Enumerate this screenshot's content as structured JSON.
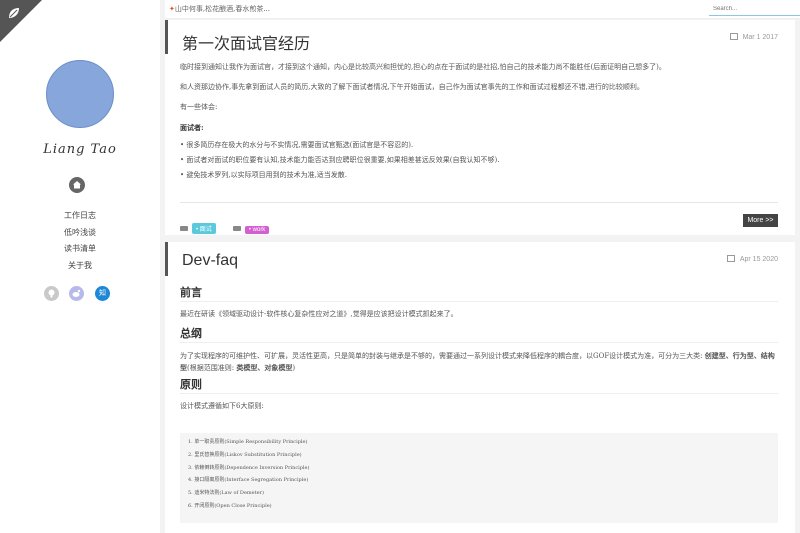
{
  "header": {
    "marquee": "山中何事,松花酿酒,春水煎茶...",
    "search_placeholder": "Search..."
  },
  "sidebar": {
    "author": "Liang Tao",
    "nav": [
      "工作日志",
      "低吟浅谈",
      "读书清单",
      "关于我"
    ],
    "social": [
      {
        "name": "github",
        "color": "#c9c9c9"
      },
      {
        "name": "weibo",
        "color": "#b6b9ea"
      },
      {
        "name": "zhihu",
        "label": "知",
        "color": "#1e88d6"
      }
    ]
  },
  "posts": [
    {
      "title": "第一次面试官经历",
      "date": "Mar 1 2017",
      "paragraphs": [
        "临时接到通知让我作为面试官，才接到这个通知，内心是比较高兴和担忧的,担心的点在于面试的是社招,怕自己的技术能力尚不能胜任(后面证明自己想多了)。",
        "和人资那边协作,事先拿到面试人员的简历,大致的了解下面试者情况,下午开始面试，自己作为面试官事先的工作和面试过程都还不错,进行的比较顺利。",
        "有一些体会:"
      ],
      "subhead": "面试者:",
      "bullets": [
        "• 很多简历存在极大的水分与不实情况,需要面试官甄选(面试官是不容忍的).",
        "• 面试者对面试的职位要有认知,技术能力能否达到应聘职位很重要,如果相差甚远反效果(自我认知不够).",
        "• 避免技术罗列,以实际项目用到的技术为准,适当发散."
      ],
      "tags": [
        {
          "label": "• 面试",
          "color": "#5bc9dc"
        },
        {
          "label": "• work",
          "color": "#d35fd0"
        }
      ],
      "more": "More >>"
    },
    {
      "title": "Dev-faq",
      "date": "Apr 15 2020",
      "sections": [
        {
          "heading": "前言",
          "text": "最近在研读《领域驱动设计-软件核心复杂性应对之道》,觉得是应该把设计模式抓起来了。"
        },
        {
          "heading": "总纲",
          "text_a": "为了实现程序的可维护性、可扩展，灵活性更高，只是简单的封装与继承是不够的，需要通过一系列设计模式来降低程序的耦合度，以GOF设计模式为准，可分为三大类: ",
          "bold_a": "创建型、行为型、结构型",
          "text_b": "(根据范围准则: ",
          "bold_b": "类模型、对象模型",
          "text_c": ")"
        },
        {
          "heading": "原则",
          "text": "设计模式遵循如下6大原则:"
        }
      ],
      "principles": [
        "1. 单一职责原则(Simple Responsibility Principle)",
        "2. 里氏替换原则(Liskov Substitution Principle)",
        "3. 依赖倒转原则(Dependence Inversion Principle)",
        "4. 接口隔离原则(Interface Segregation Principle)",
        "5. 迪米特法则(Law of Demeter)",
        "6. 开闭原则(Open Close Principle)"
      ]
    }
  ]
}
